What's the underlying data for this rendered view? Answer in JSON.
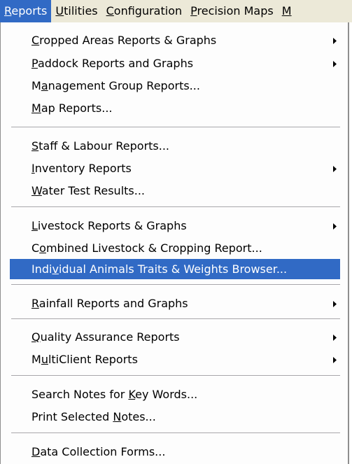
{
  "menubar": [
    {
      "pre": "",
      "acc": "R",
      "post": "eports"
    },
    {
      "pre": "",
      "acc": "U",
      "post": "tilities"
    },
    {
      "pre": "",
      "acc": "C",
      "post": "onfiguration"
    },
    {
      "pre": "",
      "acc": "P",
      "post": "recision Maps"
    },
    {
      "pre": "",
      "acc": "M",
      "post": ""
    }
  ],
  "menu": {
    "items": [
      {
        "pre": "",
        "acc": "C",
        "post": "ropped Areas Reports & Graphs"
      },
      {
        "pre": "",
        "acc": "P",
        "post": "addock Reports and Graphs"
      },
      {
        "pre": "M",
        "acc": "a",
        "post": "nagement Group Reports..."
      },
      {
        "pre": "",
        "acc": "M",
        "post": "ap Reports..."
      },
      {
        "pre": "",
        "acc": "S",
        "post": "taff & Labour Reports..."
      },
      {
        "pre": "",
        "acc": "I",
        "post": "nventory Reports"
      },
      {
        "pre": "",
        "acc": "W",
        "post": "ater Test Results..."
      },
      {
        "pre": "",
        "acc": "L",
        "post": "ivestock Reports & Graphs"
      },
      {
        "pre": "C",
        "acc": "o",
        "post": "mbined Livestock & Cropping Report..."
      },
      {
        "pre": "Indi",
        "acc": "v",
        "post": "idual Animals Traits & Weights Browser..."
      },
      {
        "pre": "",
        "acc": "R",
        "post": "ainfall Reports and Graphs"
      },
      {
        "pre": "",
        "acc": "Q",
        "post": "uality Assurance Reports"
      },
      {
        "pre": "M",
        "acc": "u",
        "post": "ltiClient Reports"
      },
      {
        "pre": "Search Notes for ",
        "acc": "K",
        "post": "ey Words..."
      },
      {
        "pre": "Print Selected ",
        "acc": "N",
        "post": "otes..."
      },
      {
        "pre": "",
        "acc": "D",
        "post": "ata Collection Forms..."
      }
    ]
  }
}
